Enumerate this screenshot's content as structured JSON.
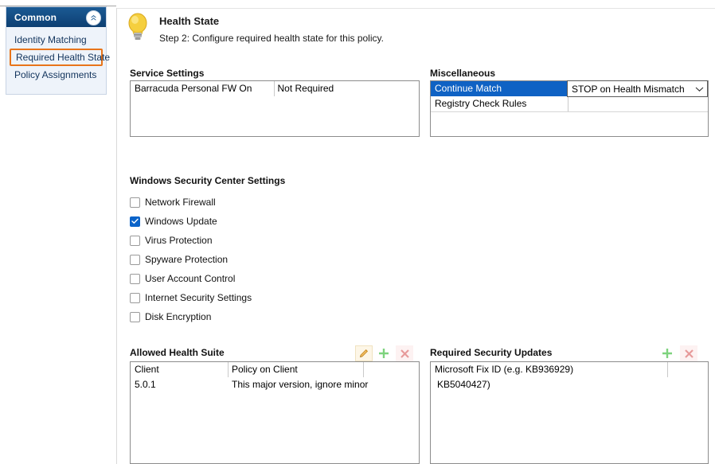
{
  "sidebar": {
    "header_title": "Common",
    "collapse_icon": "double-chevron-up-icon",
    "items": [
      {
        "label": "Identity Matching",
        "selected": false
      },
      {
        "label": "Required Health State",
        "selected": true
      },
      {
        "label": "Policy Assignments",
        "selected": false
      }
    ]
  },
  "header": {
    "icon": "lightbulb-icon",
    "title": "Health State",
    "subtitle": "Step 2: Configure required health state for this policy."
  },
  "service_settings": {
    "label": "Service Settings",
    "rows": [
      {
        "name": "Barracuda Personal FW On",
        "value": "Not Required"
      }
    ]
  },
  "miscellaneous": {
    "label": "Miscellaneous",
    "rows": [
      {
        "name": "Continue Match",
        "selected": true
      },
      {
        "name": "Registry Check Rules",
        "selected": false
      }
    ],
    "dropdown": {
      "value": "STOP on Health Mismatch",
      "arrow_icon": "chevron-down-icon"
    }
  },
  "windows_security_center": {
    "label": "Windows Security Center Settings",
    "checkboxes": [
      {
        "label": "Network Firewall",
        "checked": false
      },
      {
        "label": "Windows Update",
        "checked": true
      },
      {
        "label": "Virus Protection",
        "checked": false
      },
      {
        "label": "Spyware Protection",
        "checked": false
      },
      {
        "label": "User Account Control",
        "checked": false
      },
      {
        "label": "Internet Security Settings",
        "checked": false
      },
      {
        "label": "Disk Encryption",
        "checked": false
      }
    ]
  },
  "allowed_health_suite": {
    "label": "Allowed Health Suite",
    "actions": [
      {
        "name": "edit-icon",
        "title": "Edit"
      },
      {
        "name": "add-icon",
        "title": "Add"
      },
      {
        "name": "delete-icon",
        "title": "Delete"
      }
    ],
    "columns": [
      "Client",
      "Policy on Client"
    ],
    "rows": [
      {
        "client": "5.0.1",
        "policy": "This major version, ignore minor"
      }
    ]
  },
  "required_security_updates": {
    "label": "Required Security Updates",
    "actions": [
      {
        "name": "add-icon",
        "title": "Add"
      },
      {
        "name": "delete-icon",
        "title": "Delete"
      }
    ],
    "rows": [
      {
        "text": "Microsoft Fix ID (e.g. KB936929)"
      },
      {
        "text": "KB5040427)"
      }
    ]
  },
  "colors": {
    "sidebar_header": "#124a80",
    "sidebar_body": "#eef3fa",
    "selection_outline": "#e8741a",
    "row_selected": "#0f62c4",
    "checkbox_checked": "#0a63c9",
    "icon_add": "#7ed37e",
    "icon_delete": "#e79a9a",
    "icon_edit": "#e8a33d"
  }
}
